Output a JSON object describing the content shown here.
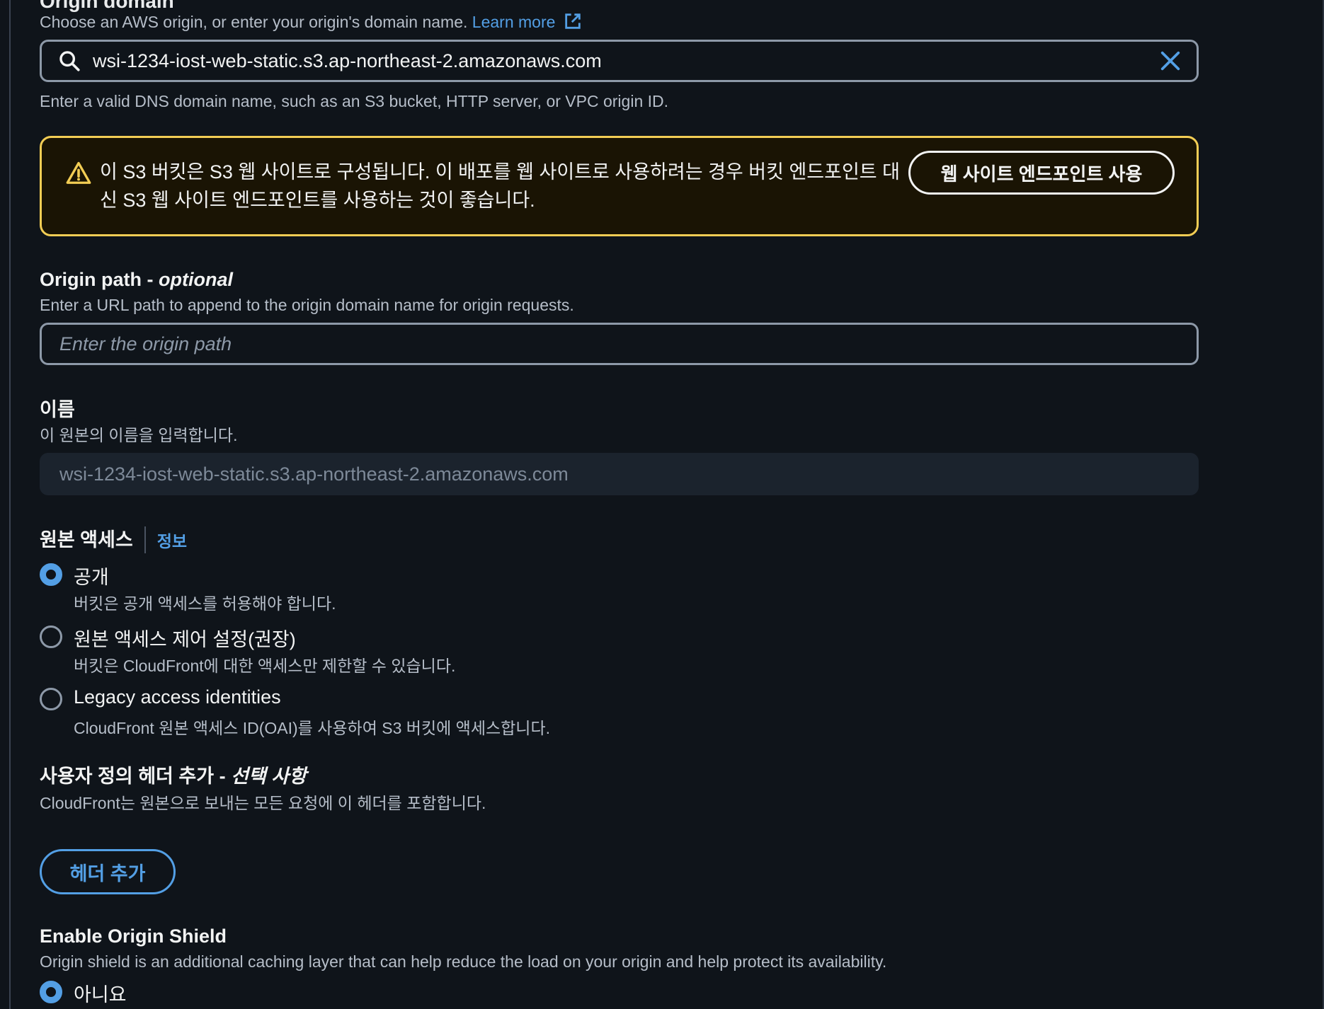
{
  "origin_domain": {
    "label": "Origin domain",
    "description": "Choose an AWS origin, or enter your origin's domain name.",
    "learn_more": "Learn more",
    "value": "wsi-1234-iost-web-static.s3.ap-northeast-2.amazonaws.com",
    "hint": "Enter a valid DNS domain name, such as an S3 bucket, HTTP server, or VPC origin ID."
  },
  "warning": {
    "line1": "이 S3 버킷은 S3 웹 사이트로 구성됩니다. 이 배포를 웹 사이트로 사용하려는 경우 버킷 엔드포인트 대",
    "line2": "신 S3 웹 사이트 엔드포인트를 사용하는 것이 좋습니다.",
    "button": "웹 사이트 엔드포인트 사용",
    "accent": "#f2cd54"
  },
  "origin_path": {
    "label": "Origin path - ",
    "label_optional": "optional",
    "description": "Enter a URL path to append to the origin domain name for origin requests.",
    "placeholder": "Enter the origin path"
  },
  "name": {
    "label": "이름",
    "description": "이 원본의 이름을 입력합니다.",
    "value": "wsi-1234-iost-web-static.s3.ap-northeast-2.amazonaws.com"
  },
  "origin_access": {
    "label": "원본 액세스",
    "info": "정보",
    "options": [
      {
        "label": "공개",
        "description": "버킷은 공개 액세스를 허용해야 합니다.",
        "selected": true
      },
      {
        "label": "원본 액세스 제어 설정(권장)",
        "description": "버킷은 CloudFront에 대한 액세스만 제한할 수 있습니다.",
        "selected": false
      },
      {
        "label": "Legacy access identities",
        "description": "CloudFront 원본 액세스 ID(OAI)를 사용하여 S3 버킷에 액세스합니다.",
        "selected": false
      }
    ]
  },
  "custom_headers": {
    "label": "사용자 정의 헤더 추가 - ",
    "label_optional": "선택 사항",
    "description": "CloudFront는 원본으로 보내는 모든 요청에 이 헤더를 포함합니다.",
    "button": "헤더 추가"
  },
  "origin_shield": {
    "label": "Enable Origin Shield",
    "description": "Origin shield is an additional caching layer that can help reduce the load on your origin and help protect its availability.",
    "options": [
      {
        "label": "아니요",
        "selected": true
      }
    ]
  },
  "colors": {
    "background": "#0f141a",
    "link": "#539fe5",
    "text": "#f2f3f3"
  }
}
